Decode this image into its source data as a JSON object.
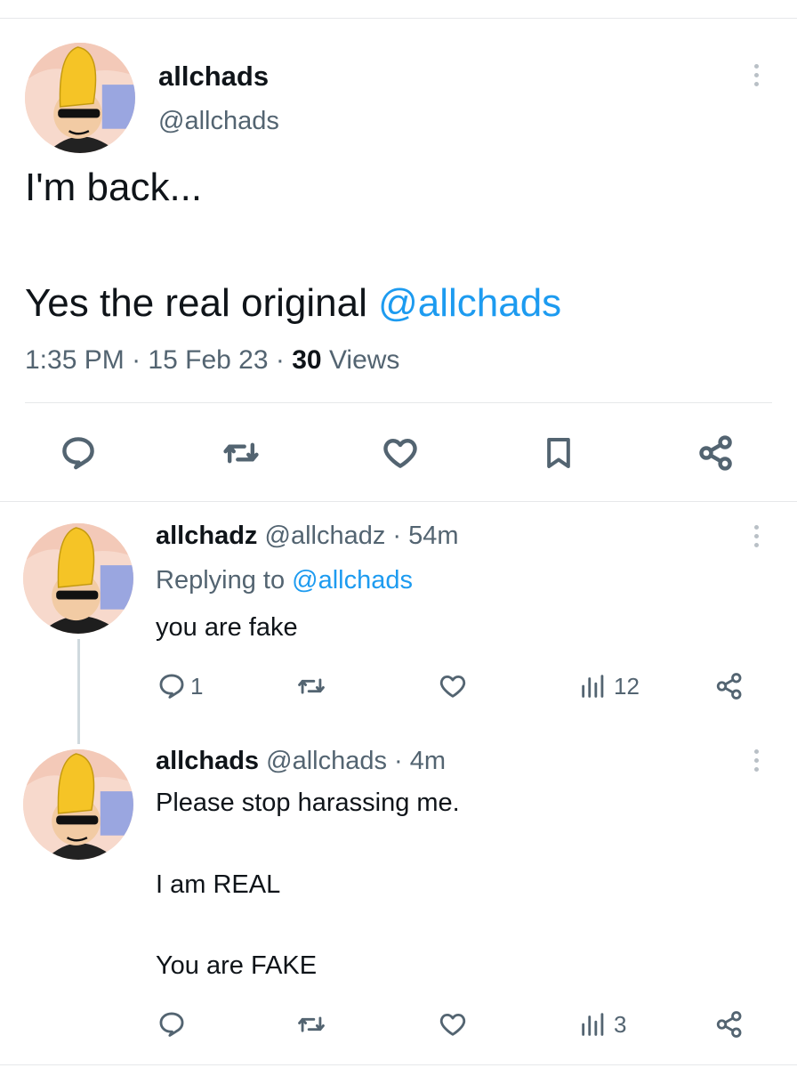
{
  "main_tweet": {
    "display_name": "allchads",
    "handle": "@allchads",
    "text_line1": "I'm back...",
    "text_line2_prefix": "Yes the real original ",
    "text_line2_mention": "@allchads",
    "time": "1:35 PM",
    "date": "15 Feb 23",
    "views_count": "30",
    "views_label": "Views",
    "actions": [
      "reply-icon",
      "retweet-icon",
      "like-icon",
      "bookmark-icon",
      "share-icon"
    ]
  },
  "replies": [
    {
      "display_name": "allchadz",
      "handle": "@allchadz",
      "time_ago": "54m",
      "replying_prefix": "Replying to ",
      "replying_to": "@allchads",
      "text": "you are fake",
      "reply_count": "1",
      "views_count": "12"
    },
    {
      "display_name": "allchads",
      "handle": "@allchads",
      "time_ago": "4m",
      "text_line1": "Please stop harassing me.",
      "text_line2": "I am REAL",
      "text_line3": "You are FAKE",
      "views_count": "3"
    }
  ],
  "separator": "·",
  "colors": {
    "link": "#1d9bf0",
    "muted": "#536471",
    "text": "#0f1419",
    "divider": "#e6e8ea"
  }
}
